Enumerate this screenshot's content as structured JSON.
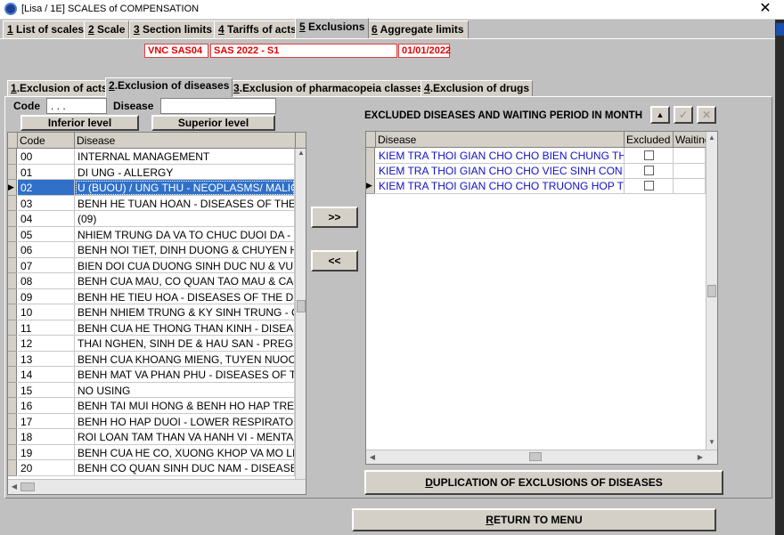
{
  "window": {
    "title": "[Lisa / 1E] SCALES of COMPENSATION",
    "close": "✕"
  },
  "tabs": [
    {
      "num": "1",
      "label": " List of scales"
    },
    {
      "num": "2",
      "label": " Scale"
    },
    {
      "num": "3",
      "label": " Section limits"
    },
    {
      "num": "4",
      "label": " Tariffs of acts"
    },
    {
      "num": "5",
      "label": " Exclusions"
    },
    {
      "num": "6",
      "label": " Aggregate limits"
    }
  ],
  "header": {
    "code": "VNC  SAS04",
    "name": "SAS 2022 - S1",
    "date": "01/01/2022"
  },
  "subtabs": [
    {
      "num": "1",
      "label": ".Exclusion of acts"
    },
    {
      "num": "2",
      "label": ".Exclusion of diseases"
    },
    {
      "num": "3",
      "label": ".Exclusion of pharmacopeia classes"
    },
    {
      "num": "4",
      "label": ".Exclusion of drugs"
    }
  ],
  "filter": {
    "code_label": "Code",
    "code_value": ".  .  .",
    "disease_label": "Disease",
    "disease_value": "",
    "inferior_btn": "Inferior level",
    "superior_btn": "Superior level"
  },
  "left_grid": {
    "columns": [
      "Code",
      "Disease"
    ],
    "rows": [
      {
        "code": "00",
        "disease": "INTERNAL MANAGEMENT"
      },
      {
        "code": "01",
        "disease": "DI UNG - ALLERGY"
      },
      {
        "code": "02",
        "disease": "U (BUOU) / UNG THU - NEOPLASMS/ MALIGNANT"
      },
      {
        "code": "03",
        "disease": "BENH HE TUAN HOAN - DISEASES OF THE CIRCULATORY"
      },
      {
        "code": "04",
        "disease": "(09)"
      },
      {
        "code": "05",
        "disease": "NHIEM TRUNG DA VA TO CHUC DUOI DA - D"
      },
      {
        "code": "06",
        "disease": "BENH NOI TIET, DINH DUONG & CHUYEN HOA"
      },
      {
        "code": "07",
        "disease": "BIEN DOI CUA DUONG SINH DUC NU & VU - "
      },
      {
        "code": "08",
        "disease": "BENH CUA MAU, CO QUAN TAO MAU & CAC"
      },
      {
        "code": "09",
        "disease": "BENH HE TIEU HOA - DISEASES OF THE DIGESTIVE"
      },
      {
        "code": "10",
        "disease": "BENH NHIEM TRUNG & KY SINH TRUNG - CE"
      },
      {
        "code": "11",
        "disease": "BENH CUA HE THONG THAN KINH - DISEASES"
      },
      {
        "code": "12",
        "disease": "THAI NGHEN, SINH DE & HAU SAN - PREGNANCY"
      },
      {
        "code": "13",
        "disease": "BENH CUA KHOANG MIENG, TUYEN NUOC BOT"
      },
      {
        "code": "14",
        "disease": "BENH MAT VA PHAN PHU - DISEASES OF THE EYE"
      },
      {
        "code": "15",
        "disease": "NO USING"
      },
      {
        "code": "16",
        "disease": "BENH TAI MUI HONG & BENH HO HAP TREN"
      },
      {
        "code": "17",
        "disease": "BENH HO HAP DUOI - LOWER RESPIRATORY"
      },
      {
        "code": "18",
        "disease": "ROI LOAN TAM THAN VA HANH VI - MENTAL"
      },
      {
        "code": "19",
        "disease": "BENH CUA HE CO, XUONG KHOP VA MO LIEN"
      },
      {
        "code": "20",
        "disease": "BENH CO QUAN SINH DUC NAM - DISEASES"
      }
    ],
    "selected_index": 2
  },
  "move_buttons": {
    "add": ">>",
    "remove": "<<"
  },
  "right": {
    "title": "EXCLUDED DISEASES AND WAITING PERIOD IN MONTH",
    "up_icon": "▲",
    "check_icon": "✓",
    "x_icon": "✕",
    "columns": [
      "Disease",
      "Excluded",
      "Waiting period"
    ],
    "rows": [
      {
        "disease": "KIEM TRA THOI GIAN CHO CHO BIEN CHUNG THAI SAN",
        "excluded": false,
        "waiting": ""
      },
      {
        "disease": "KIEM TRA THOI GIAN CHO CHO VIEC SINH CON - CHILDBIRTH",
        "excluded": false,
        "waiting": ""
      },
      {
        "disease": "KIEM TRA THOI GIAN CHO CHO TRUONG HOP TU VONG",
        "excluded": false,
        "waiting": ""
      }
    ],
    "current_index": 2
  },
  "dup_button": {
    "first": "D",
    "rest": "UPLICATION OF EXCLUSIONS OF DISEASES"
  },
  "return_button": {
    "first": "R",
    "rest": "ETURN TO MENU"
  },
  "colors": {
    "selection": "#3070c8",
    "link_text": "#1010c8",
    "header_red": "#e00000"
  }
}
